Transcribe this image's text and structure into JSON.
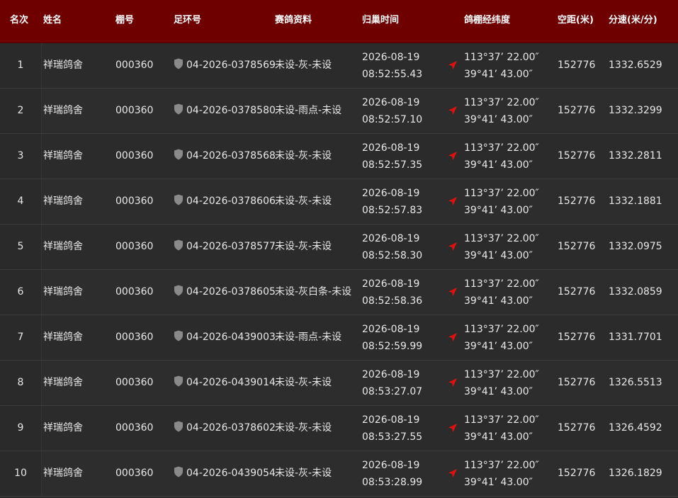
{
  "header": {
    "rank": "名次",
    "name": "姓名",
    "loft": "棚号",
    "ring": "足环号",
    "info": "赛鸽资料",
    "time": "归巢时间",
    "coords": "鸽棚经纬度",
    "distance": "空距(米)",
    "speed": "分速(米/分)"
  },
  "colors": {
    "header_bg": "#6e0000",
    "row_bg": "#2b2b2b",
    "gps_icon": "#e01010",
    "shield_icon": "#8a8a8a"
  },
  "rows": [
    {
      "rank": "1",
      "name": "祥瑞鸽舍",
      "loft": "000360",
      "ring": "04-2026-0378569",
      "info": "未设-灰-未设",
      "date": "2026-08-19",
      "time": "08:52:55.43",
      "lon": "113°37’ 22.00″",
      "lat": "39°41’ 43.00″",
      "distance": "152776",
      "speed": "1332.6529"
    },
    {
      "rank": "2",
      "name": "祥瑞鸽舍",
      "loft": "000360",
      "ring": "04-2026-0378580",
      "info": "未设-雨点-未设",
      "date": "2026-08-19",
      "time": "08:52:57.10",
      "lon": "113°37’ 22.00″",
      "lat": "39°41’ 43.00″",
      "distance": "152776",
      "speed": "1332.3299"
    },
    {
      "rank": "3",
      "name": "祥瑞鸽舍",
      "loft": "000360",
      "ring": "04-2026-0378568",
      "info": "未设-灰-未设",
      "date": "2026-08-19",
      "time": "08:52:57.35",
      "lon": "113°37’ 22.00″",
      "lat": "39°41’ 43.00″",
      "distance": "152776",
      "speed": "1332.2811"
    },
    {
      "rank": "4",
      "name": "祥瑞鸽舍",
      "loft": "000360",
      "ring": "04-2026-0378606",
      "info": "未设-灰-未设",
      "date": "2026-08-19",
      "time": "08:52:57.83",
      "lon": "113°37’ 22.00″",
      "lat": "39°41’ 43.00″",
      "distance": "152776",
      "speed": "1332.1881"
    },
    {
      "rank": "5",
      "name": "祥瑞鸽舍",
      "loft": "000360",
      "ring": "04-2026-0378577",
      "info": "未设-灰-未设",
      "date": "2026-08-19",
      "time": "08:52:58.30",
      "lon": "113°37’ 22.00″",
      "lat": "39°41’ 43.00″",
      "distance": "152776",
      "speed": "1332.0975"
    },
    {
      "rank": "6",
      "name": "祥瑞鸽舍",
      "loft": "000360",
      "ring": "04-2026-0378605",
      "info": "未设-灰白条-未设",
      "date": "2026-08-19",
      "time": "08:52:58.36",
      "lon": "113°37’ 22.00″",
      "lat": "39°41’ 43.00″",
      "distance": "152776",
      "speed": "1332.0859"
    },
    {
      "rank": "7",
      "name": "祥瑞鸽舍",
      "loft": "000360",
      "ring": "04-2026-0439003",
      "info": "未设-雨点-未设",
      "date": "2026-08-19",
      "time": "08:52:59.99",
      "lon": "113°37’ 22.00″",
      "lat": "39°41’ 43.00″",
      "distance": "152776",
      "speed": "1331.7701"
    },
    {
      "rank": "8",
      "name": "祥瑞鸽舍",
      "loft": "000360",
      "ring": "04-2026-0439014",
      "info": "未设-灰-未设",
      "date": "2026-08-19",
      "time": "08:53:27.07",
      "lon": "113°37’ 22.00″",
      "lat": "39°41’ 43.00″",
      "distance": "152776",
      "speed": "1326.5513"
    },
    {
      "rank": "9",
      "name": "祥瑞鸽舍",
      "loft": "000360",
      "ring": "04-2026-0378602",
      "info": "未设-灰-未设",
      "date": "2026-08-19",
      "time": "08:53:27.55",
      "lon": "113°37’ 22.00″",
      "lat": "39°41’ 43.00″",
      "distance": "152776",
      "speed": "1326.4592"
    },
    {
      "rank": "10",
      "name": "祥瑞鸽舍",
      "loft": "000360",
      "ring": "04-2026-0439054",
      "info": "未设-灰-未设",
      "date": "2026-08-19",
      "time": "08:53:28.99",
      "lon": "113°37’ 22.00″",
      "lat": "39°41’ 43.00″",
      "distance": "152776",
      "speed": "1326.1829"
    }
  ]
}
